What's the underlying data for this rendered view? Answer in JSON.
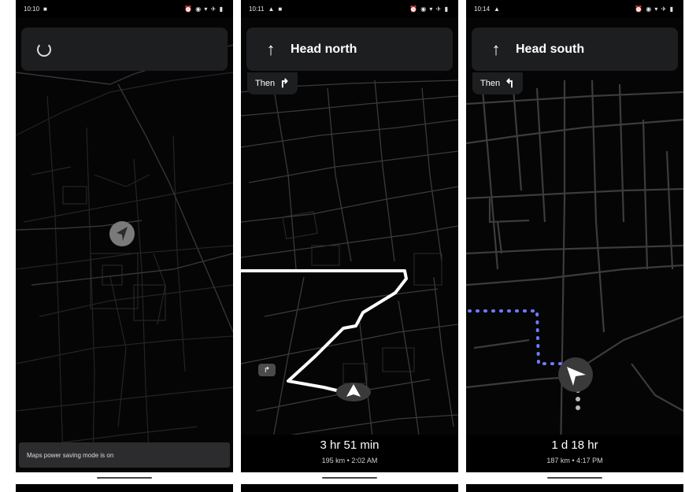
{
  "screens": [
    {
      "status_time": "10:10",
      "status_icons": "⏰ ◉ ▾ ✈ ▮",
      "loading": true,
      "toast": "Maps power saving mode is on"
    },
    {
      "status_time": "10:11",
      "status_icons": "⏰ ◉ ▾ ✈ ▮",
      "instruction": "Head north",
      "instruction_arrow": "↑",
      "then_label": "Then",
      "then_arrow": "↱",
      "turn_chip": "↱",
      "eta": "3 hr 51 min",
      "eta_detail": "195 km • 2:02 AM"
    },
    {
      "status_time": "10:14",
      "status_icons": "⏰ ◉ ▾ ✈ ▮",
      "instruction": "Head south",
      "instruction_arrow": "↑",
      "then_label": "Then",
      "then_arrow": "↰",
      "eta": "1 d 18 hr",
      "eta_detail": "187 km • 4:17 PM"
    }
  ],
  "colors": {
    "route": "#ffffff",
    "walking_dots": "#6f7bff",
    "card": "#1d1e20",
    "roads": "#2e2e2e"
  }
}
